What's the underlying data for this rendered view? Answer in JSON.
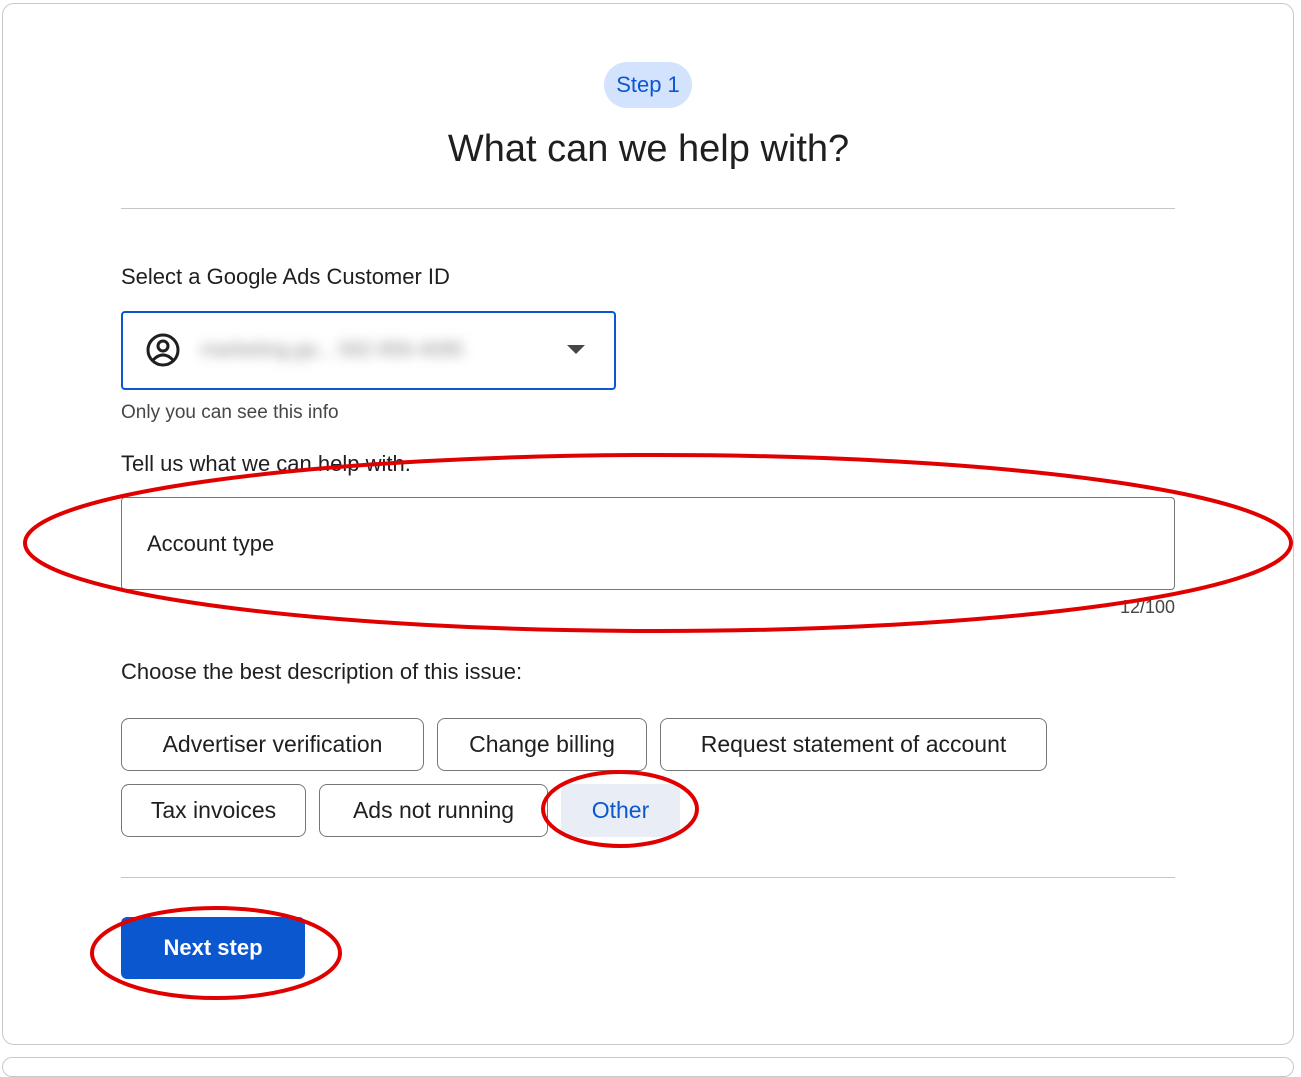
{
  "header": {
    "step_label": "Step 1",
    "title": "What can we help with?"
  },
  "customer_id": {
    "label": "Select a Google Ads Customer ID",
    "selected_value": "marketing.ga... 582-956-4095",
    "helper": "Only you can see this info"
  },
  "help_field": {
    "label": "Tell us what we can help with.",
    "value": "Account type",
    "counter": "12/100"
  },
  "issue": {
    "label": "Choose the best description of this issue:",
    "options": [
      "Advertiser verification",
      "Change billing",
      "Request statement of account",
      "Tax invoices",
      "Ads not running",
      "Other"
    ],
    "selected": "Other"
  },
  "actions": {
    "next_label": "Next step"
  },
  "colors": {
    "primary": "#0b57d0",
    "chip_selected_bg": "#e9eef6",
    "step_chip_bg": "#d3e3fd",
    "annotation": "#e00000"
  }
}
